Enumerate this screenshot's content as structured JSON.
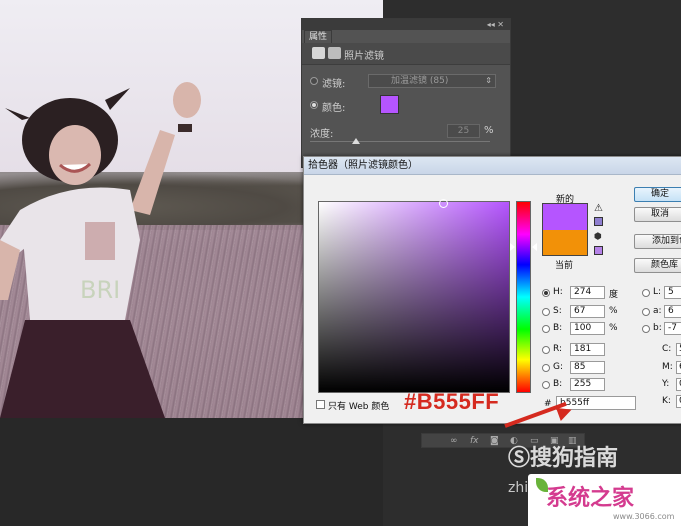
{
  "colors": {
    "new_color": "#b555ff",
    "current_color": "#f29108",
    "annotation_red": "#d52a1f"
  },
  "properties_panel": {
    "tab_label": "属性",
    "collapse_glyphs": "◂◂ ✕",
    "adjustment_label": "照片滤镜",
    "filter_label": "滤镜:",
    "filter_value": "加温滤镜 (85)",
    "color_label": "颜色:",
    "density_label": "浓度:",
    "density_value": "25",
    "density_unit": "%"
  },
  "color_picker": {
    "title": "拾色器（照片滤镜颜色）",
    "new_label": "新的",
    "current_label": "当前",
    "buttons": {
      "ok": "确定",
      "cancel": "取消",
      "add_swatches": "添加到色板",
      "color_libraries": "颜色库"
    },
    "hsb": {
      "h_label": "H:",
      "h_value": "274",
      "h_unit": "度",
      "s_label": "S:",
      "s_value": "67",
      "s_unit": "%",
      "b_label": "B:",
      "b_value": "100",
      "b_unit": "%"
    },
    "rgb": {
      "r_label": "R:",
      "r_value": "181",
      "g_label": "G:",
      "g_value": "85",
      "b_label": "B:",
      "b_value": "255"
    },
    "lab": {
      "l_label": "L:",
      "l_value": "5",
      "a_label": "a:",
      "a_value": "6",
      "b_label": "b:",
      "b_value": "-7"
    },
    "cmyk": {
      "c_label": "C:",
      "c_value": "5",
      "m_label": "M:",
      "m_value": "6",
      "y_label": "Y:",
      "y_value": "0",
      "k_label": "K:",
      "k_value": "0"
    },
    "web_only_label": "只有 Web 颜色",
    "hash": "#",
    "hex_value": "b555ff"
  },
  "annotation": {
    "hex_callout": "#B555FF"
  },
  "watermarks": {
    "sogou": "Ⓢ搜狗指南",
    "zhi": "zhi",
    "site_main": "系统之家",
    "site_sub": "www.3066.com"
  }
}
